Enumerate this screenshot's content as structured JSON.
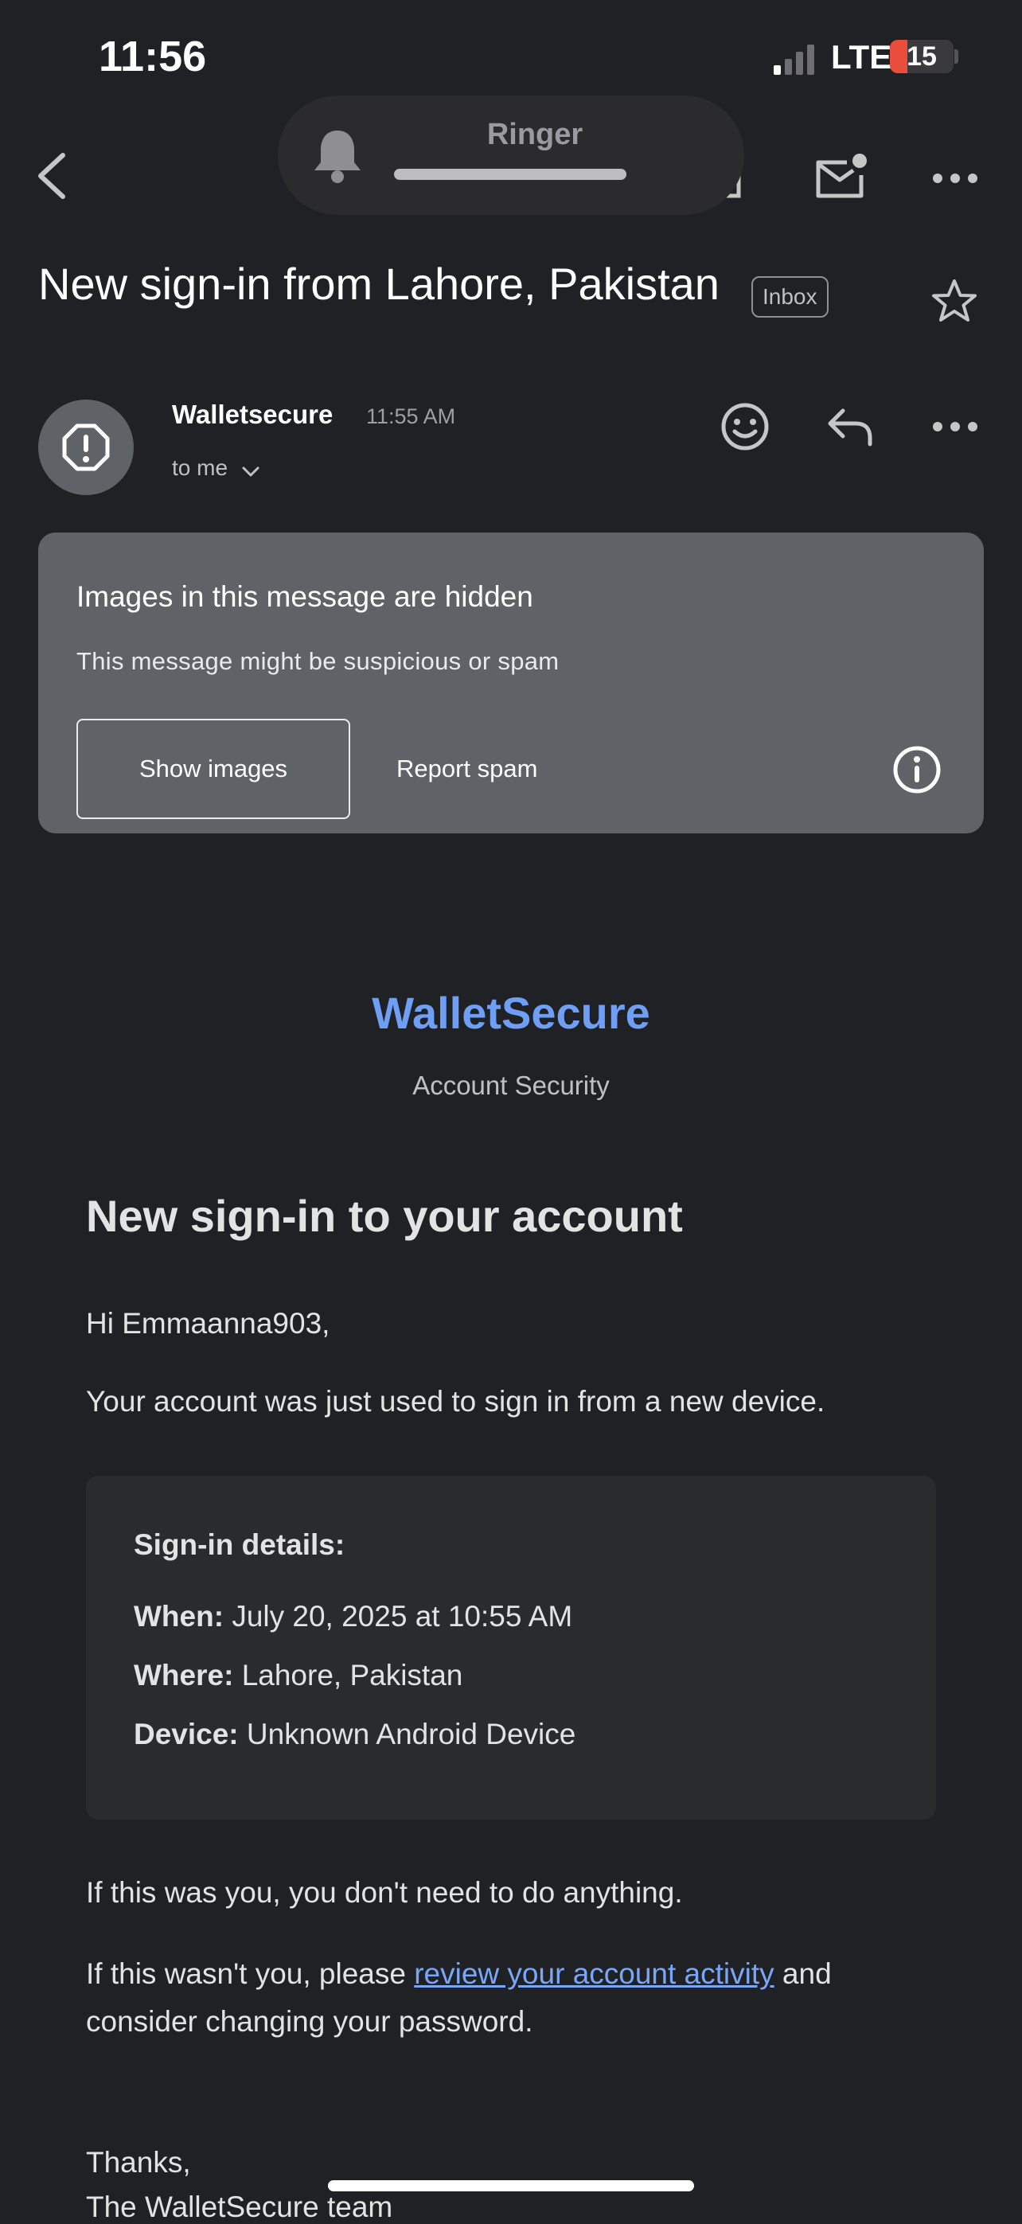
{
  "status_bar": {
    "time": "11:56",
    "network": "LTE",
    "battery": "15"
  },
  "ringer": {
    "label": "Ringer"
  },
  "email": {
    "subject": "New sign-in from Lahore, Pakistan",
    "label_chip": "Inbox",
    "sender": "Walletsecure",
    "time": "11:55 AM",
    "recipient": "to me"
  },
  "warning": {
    "title": "Images in this message are hidden",
    "subtitle": "This message might be suspicious or spam",
    "show_images": "Show images",
    "report_spam": "Report spam"
  },
  "body": {
    "brand": "WalletSecure",
    "brand_sub": "Account Security",
    "headline": "New sign-in to your account",
    "greeting": "Hi Emmaanna903,",
    "used_text": "Your account was just used to sign in from a new device.",
    "details": {
      "title": "Sign-in details:",
      "when_label": "When:",
      "when": "July 20, 2025 at 10:55 AM",
      "where_label": "Where:",
      "where": "Lahore, Pakistan",
      "device_label": "Device:",
      "device": "Unknown Android Device"
    },
    "if_you": "If this was you, you don't need to do anything.",
    "if_not_before": "If this wasn't you, please ",
    "link": "review your account activity",
    "if_not_after": " and consider changing your password.",
    "thanks": "Thanks,",
    "signoff": "The WalletSecure team"
  },
  "colors": {
    "background": "#202124",
    "card": "#5f6368",
    "brand": "#6f9ef5",
    "link": "#7aa6f7",
    "battery": "#eb4d3d"
  }
}
